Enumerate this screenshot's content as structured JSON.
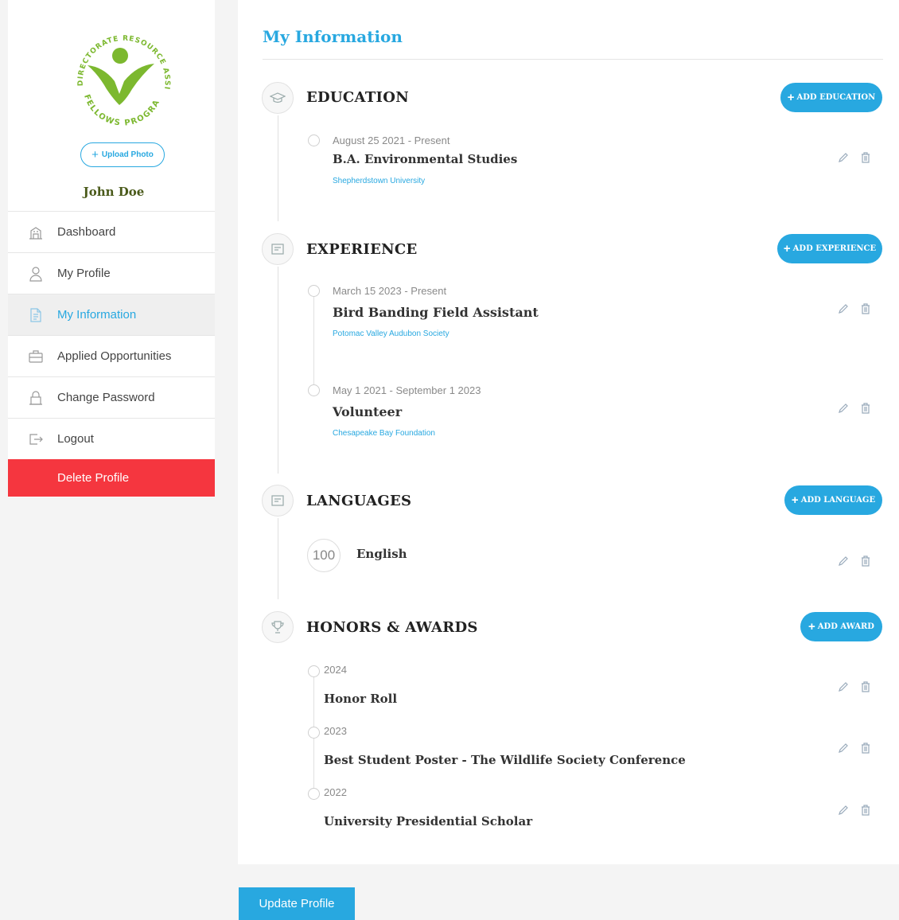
{
  "colors": {
    "accent": "#28a8e0",
    "danger": "#f5363f",
    "logo_green": "#7cb82f"
  },
  "sidebar": {
    "logo": {
      "top_text": "DIRECTORATE RESOURCE ASSISTANTS",
      "bottom_text": "FELLOWS PROGRAM"
    },
    "upload_label": "Upload Photo",
    "user_name": "John Doe",
    "items": [
      {
        "label": "Dashboard",
        "icon": "building-icon"
      },
      {
        "label": "My Profile",
        "icon": "user-icon"
      },
      {
        "label": "My Information",
        "icon": "document-icon",
        "active": true
      },
      {
        "label": "Applied Opportunities",
        "icon": "briefcase-icon"
      },
      {
        "label": "Change Password",
        "icon": "lock-icon"
      },
      {
        "label": "Logout",
        "icon": "logout-icon"
      }
    ],
    "delete_label": "Delete Profile"
  },
  "main": {
    "title": "My Information",
    "education": {
      "title": "EDUCATION",
      "add_label": "Add Education",
      "items": [
        {
          "date": "August 25 2021 - Present",
          "title": "B.A. Environmental Studies",
          "org": "Shepherdstown University"
        }
      ]
    },
    "experience": {
      "title": "EXPERIENCE",
      "add_label": "Add Experience",
      "items": [
        {
          "date": "March 15 2023 - Present",
          "title": "Bird Banding Field Assistant",
          "org": "Potomac Valley Audubon Society"
        },
        {
          "date": "May 1 2021 - September 1 2023",
          "title": "Volunteer",
          "org": "Chesapeake Bay Foundation"
        }
      ]
    },
    "languages": {
      "title": "LANGUAGES",
      "add_label": "Add Language",
      "items": [
        {
          "level": "100",
          "name": "English"
        }
      ]
    },
    "awards": {
      "title": "HONORS & AWARDS",
      "add_label": "Add Award",
      "items": [
        {
          "year": "2024",
          "title": "Honor Roll"
        },
        {
          "year": "2023",
          "title": "Best Student Poster - The Wildlife Society Conference"
        },
        {
          "year": "2022",
          "title": "University Presidential Scholar"
        }
      ]
    }
  },
  "update_label": "Update Profile"
}
